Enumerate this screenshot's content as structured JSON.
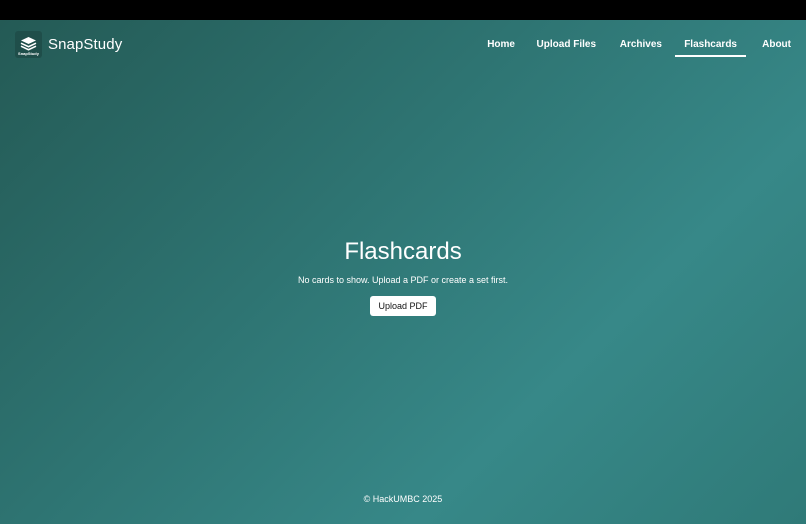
{
  "brand": {
    "name": "SnapStudy",
    "logo_text": "SnapStudy"
  },
  "nav": {
    "items": [
      {
        "label": "Home"
      },
      {
        "label": "Upload Files"
      },
      {
        "label": "Archives"
      },
      {
        "label": "Flashcards",
        "active": true
      },
      {
        "label": "About"
      }
    ]
  },
  "main": {
    "title": "Flashcards",
    "message": "No cards to show. Upload a PDF or create a set first.",
    "upload_label": "Upload PDF"
  },
  "footer": {
    "text": "© HackUMBC 2025"
  },
  "colors": {
    "gradient_start": "#245a55",
    "gradient_end": "#378888",
    "text": "#ffffff"
  }
}
